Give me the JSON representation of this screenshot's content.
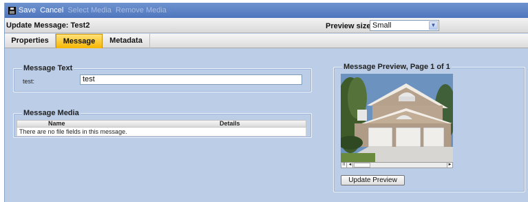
{
  "toolbar": {
    "save_label": "Save",
    "cancel_label": "Cancel",
    "select_media_label": "Select Media",
    "remove_media_label": "Remove Media"
  },
  "header": {
    "title": "Update Message: Test2",
    "preview_size_label": "Preview size:",
    "preview_size_value": "Small"
  },
  "tabs": [
    {
      "label": "Properties",
      "active": false
    },
    {
      "label": "Message",
      "active": true
    },
    {
      "label": "Metadata",
      "active": false
    }
  ],
  "message_text": {
    "legend": "Message Text",
    "field_label": "test:",
    "field_value": "test"
  },
  "message_media": {
    "legend": "Message Media",
    "columns": [
      "Name",
      "Details"
    ],
    "empty_text": "There are no file fields in this message."
  },
  "preview": {
    "legend": "Message Preview, Page 1 of 1",
    "update_button": "Update Preview"
  },
  "colors": {
    "accent_tab": "#f7b500",
    "toolbar": "#5b80c4",
    "panel_bg": "#bccde7"
  }
}
